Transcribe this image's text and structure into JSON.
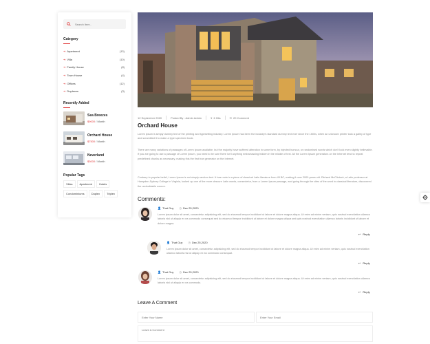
{
  "sidebar": {
    "search_placeholder": "Search Item..",
    "category_title": "Category",
    "categories": [
      {
        "label": "Apartment",
        "count": "(13)"
      },
      {
        "label": "Villa",
        "count": "(10)"
      },
      {
        "label": "Family House",
        "count": "(8)"
      },
      {
        "label": "Town House",
        "count": "(4)"
      },
      {
        "label": "Offices",
        "count": "(12)"
      },
      {
        "label": "Duplexes",
        "count": "(3)"
      }
    ],
    "recent_title": "Recently Added",
    "recent": [
      {
        "name": "Sea Breezes",
        "price": "$9000",
        "per": " / Month"
      },
      {
        "name": "Orchard House",
        "price": "$7500",
        "per": " / Month"
      },
      {
        "name": "Neverland",
        "price": "$3000",
        "per": " / Month"
      }
    ],
    "tags_title": "Popular Tags",
    "tags": [
      "Villas",
      "Apartment",
      "Hotels",
      "Condominiums",
      "Duplex",
      "Triplex"
    ]
  },
  "post": {
    "date": "12 September 2020",
    "posted_by": "Posted By : Admin Admin",
    "hits": "6 Hits",
    "comments": "20 Comment",
    "title": "Orchard House",
    "paragraphs": [
      "Lorem ipsum is simply dummy text of the printing and typesetting industry. Lorem Ipsum has been the industry's standard dummy text ever since the 1500s, when an unknown printer took a galley of type and scrambled it to make a type specimen book.",
      "There are many variations of passages of Lorem Ipsum available, but the majority have suffered alteration in some form, by injected humour, or randomised words which don't look even slightly believable. If you are going to use a passage of Lorem Ipsum, you need to be sure there isn't anything embarrassing hidden in the middle of text. All the Lorem Ipsum generators on the Internet tend to repeat predefined chunks as necessary, making this the first true generator on the Internet.",
      "Contrary to popular belief, Lorem Ipsum is not simply random text. It has roots in a piece of classical Latin literature from 45 BC, making it over 2000 years old. Richard McClintock, a Latin professor at Hampden-Sydney College in Virginia, looked up one of the more obscure Latin words, consectetur, from a Lorem Ipsum passage, and going through the cites of the word in classical literature, discovered the undoubtable source."
    ]
  },
  "comments_title": "Comments:",
  "comments": [
    {
      "author": "That Guy",
      "date": "Dec 25,2020",
      "text": "Lorem ipsum dolor sit amet, consectetur adipisicing elit, sed do eiusmod tempor incididunt ut labore et dolore magna aliqua. Ut enim ad minim veniam, quis nostrud exercitation ullamco laboris nisi ut aliquip ex ea commodo consequat sed do eiusmod tempor incididunt ut labore et dolore magna aliqua sed quis nostrud exercitation ullamco laboris incididunt ut labore et dolore magna.",
      "reply": "Reply"
    },
    {
      "author": "That Guy",
      "date": "Dec 25,2020",
      "text": "Lorem ipsum dolor sit amet, consectetur adipisicing elit, sed do eiusmod tempor incididunt ut labore et dolore magna aliqua. Ut enim ad minim veniam, quis nostrud exercitation ullamco laboris nisi ut aliquip ex ea commodo consequat.",
      "reply": "Reply"
    },
    {
      "author": "That Guy",
      "date": "Dec 25,2020",
      "text": "Lorem ipsum dolor sit amet, consectetur adipisicing elit, sed do eiusmod tempor incididunt ut labore et dolore magna aliqua. Ut enim ad minim veniam, quis nostrud exercitation ullamco laboris nisi ut aliquip ex ea commodo.",
      "reply": "Reply"
    }
  ],
  "leave_comment": {
    "title": "Leave A Comment",
    "name_placeholder": "Enter Your Name",
    "email_placeholder": "Enter Your Email",
    "comment_placeholder": "Leave A Comment"
  },
  "colors": {
    "accent": "#e13c3c"
  },
  "icons": [
    "search-icon",
    "user-icon",
    "clock-icon",
    "heart-icon",
    "comment-icon",
    "reply-icon",
    "gear-icon"
  ]
}
